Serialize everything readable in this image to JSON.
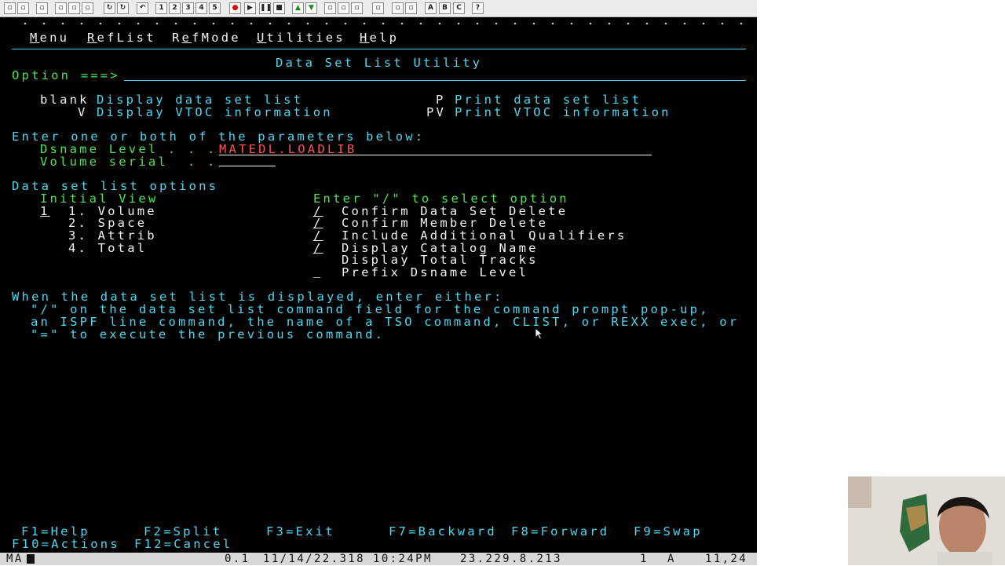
{
  "toolbar": {
    "icons": [
      "new-icon",
      "open-icon",
      "print-icon",
      "cut-icon",
      "copy-icon",
      "paste-icon",
      "refresh-icon",
      "connect-icon",
      "undo-icon",
      "macro1-icon",
      "macro2-icon",
      "macro3-icon",
      "macro4-icon",
      "macro5-icon",
      "record-icon",
      "play-icon",
      "pause-icon",
      "stop-icon",
      "up-icon",
      "down-icon",
      "layout1-icon",
      "layout2-icon",
      "layout3-icon",
      "send-icon",
      "receive-icon",
      "edit-icon",
      "a-icon",
      "b-icon",
      "c-icon",
      "help-icon"
    ],
    "letters": {
      "a": "A",
      "b": "B",
      "c": "C",
      "help": "?"
    }
  },
  "menu": {
    "items": [
      "Menu",
      "RefList",
      "RefMode",
      "Utilities",
      "Help"
    ]
  },
  "panel": {
    "title": "Data Set List Utility",
    "option_prompt": "Option ===>",
    "actions": [
      {
        "key": "blank",
        "desc": "Display data set list"
      },
      {
        "key": "V",
        "desc": "Display VTOC information"
      },
      {
        "key": "P",
        "desc": "Print data set list"
      },
      {
        "key": "PV",
        "desc": "Print VTOC information"
      }
    ],
    "params_heading": "Enter one or both of the parameters below:",
    "dsname_label": "Dsname Level . . .",
    "dsname_value": "MATEDL.LOADLIB",
    "volume_label": "Volume serial  . .",
    "volume_value": "",
    "options_heading": "Data set list options",
    "initial_view_heading": "Initial View",
    "initial_view_value": "1",
    "views": [
      "1. Volume",
      "2. Space",
      "3. Attrib",
      "4. Total"
    ],
    "select_heading": "Enter \"/\" to select option",
    "options": [
      {
        "mark": "/",
        "label": "Confirm Data Set Delete"
      },
      {
        "mark": "/",
        "label": "Confirm Member Delete"
      },
      {
        "mark": "/",
        "label": "Include Additional Qualifiers"
      },
      {
        "mark": "/",
        "label": "Display Catalog Name"
      },
      {
        "mark": "",
        "label": "Display Total Tracks"
      },
      {
        "mark": "_",
        "label": "Prefix Dsname Level"
      }
    ],
    "help_lines": [
      "When the data set list is displayed, enter either:",
      "\"/\" on the data set list command field for the command prompt pop-up,",
      "an ISPF line command, the name of a TSO command, CLIST, or REXX exec, or",
      "\"=\" to execute the previous command."
    ]
  },
  "fkeys": {
    "row1": [
      "F1=Help",
      "F2=Split",
      "F3=Exit",
      "F7=Backward",
      "F8=Forward",
      "F9=Swap"
    ],
    "row2": [
      "F10=Actions",
      "F12=Cancel"
    ]
  },
  "status": {
    "session": "MA",
    "field1": "0.1",
    "timestamp": "11/14/22.318",
    "time": "10:24PM",
    "host": "23.229.8.213",
    "num": "1",
    "mode": "A",
    "cursor_pos": "11,24"
  },
  "colors": {
    "green": "#4fe34f",
    "turquoise": "#4fd6f2",
    "white": "#f2f2f2",
    "background": "#000000"
  }
}
